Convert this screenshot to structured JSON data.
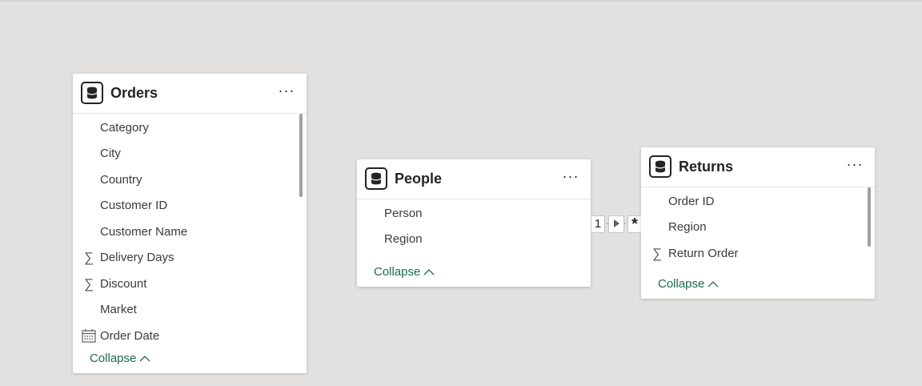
{
  "tables": {
    "orders": {
      "title": "Orders",
      "more_label": "···",
      "fields": [
        {
          "label": "Category",
          "icon": ""
        },
        {
          "label": "City",
          "icon": ""
        },
        {
          "label": "Country",
          "icon": ""
        },
        {
          "label": "Customer ID",
          "icon": ""
        },
        {
          "label": "Customer Name",
          "icon": ""
        },
        {
          "label": "Delivery Days",
          "icon": "sigma-icon"
        },
        {
          "label": "Discount",
          "icon": "sigma-icon"
        },
        {
          "label": "Market",
          "icon": ""
        },
        {
          "label": "Order Date",
          "icon": "calendar-icon"
        }
      ],
      "collapse_label": "Collapse"
    },
    "people": {
      "title": "People",
      "more_label": "···",
      "fields": [
        {
          "label": "Person",
          "icon": ""
        },
        {
          "label": "Region",
          "icon": ""
        }
      ],
      "collapse_label": "Collapse"
    },
    "returns": {
      "title": "Returns",
      "more_label": "···",
      "fields": [
        {
          "label": "Order ID",
          "icon": ""
        },
        {
          "label": "Region",
          "icon": ""
        },
        {
          "label": "Return Order",
          "icon": "sigma-icon"
        }
      ],
      "collapse_label": "Collapse"
    }
  },
  "relationship": {
    "from_cardinality": "1",
    "to_cardinality": "*",
    "direction_icon": "triangle-right-icon"
  },
  "colors": {
    "canvas": "#e2e1df",
    "collapse_link": "#1d6a4e"
  }
}
